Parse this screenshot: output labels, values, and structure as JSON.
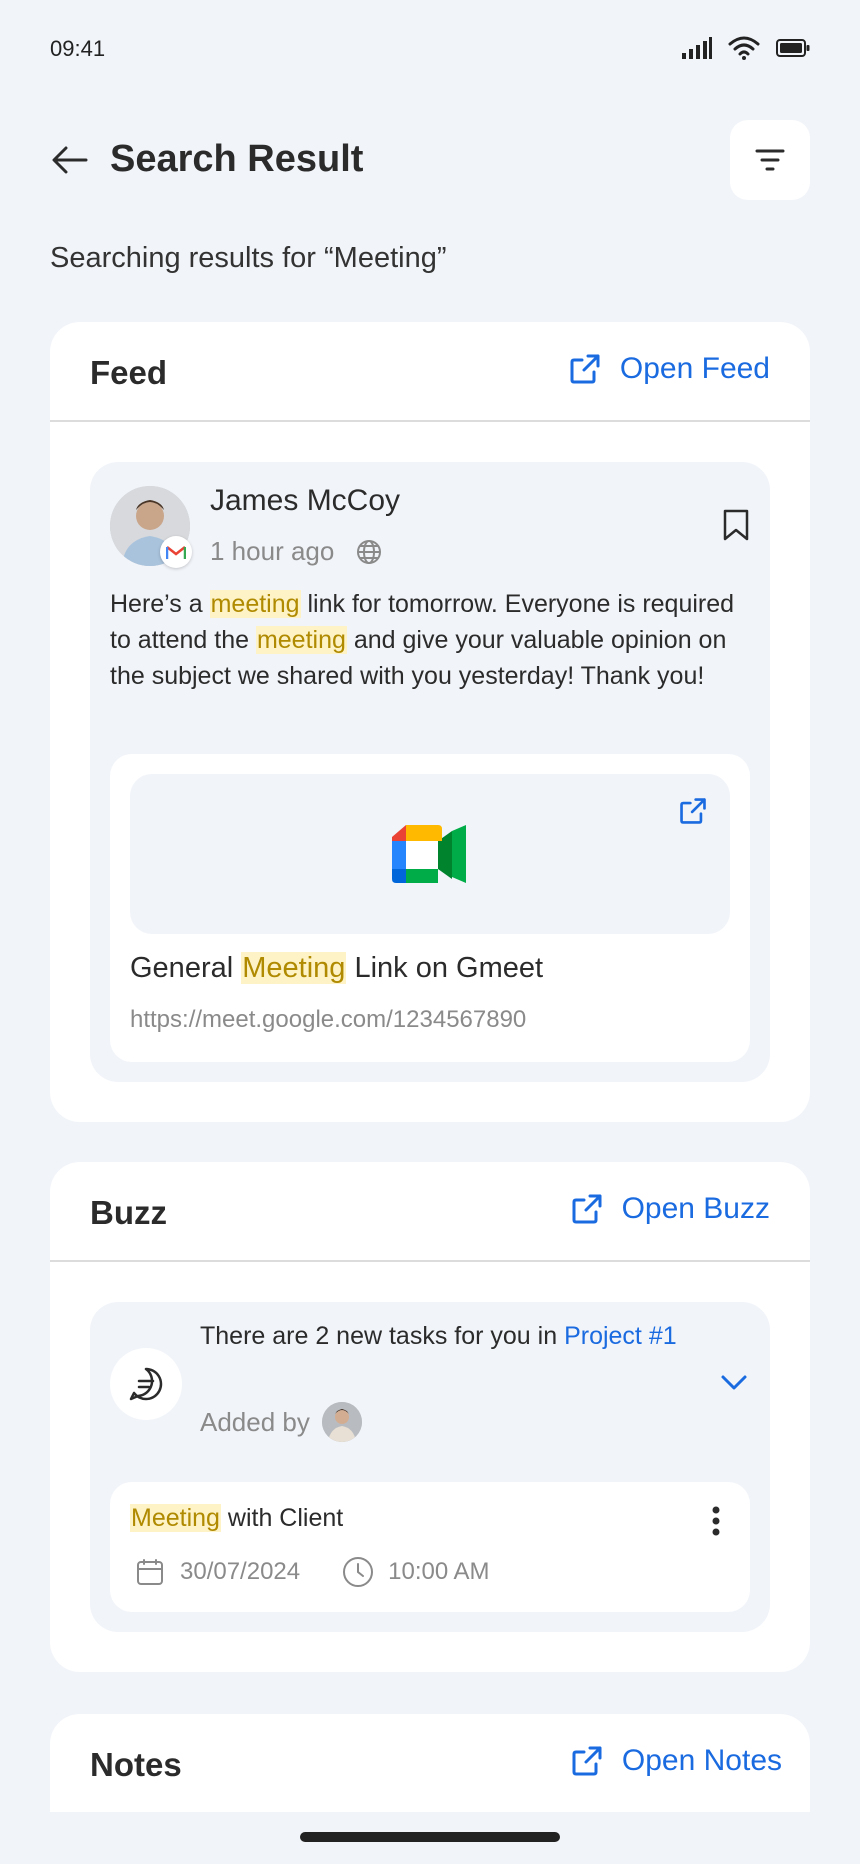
{
  "status": {
    "time": "09:41"
  },
  "header": {
    "title": "Search Result"
  },
  "search": {
    "prefix": "Searching results for “",
    "query": "Meeting",
    "suffix": "”"
  },
  "feed": {
    "title": "Feed",
    "open_label": "Open Feed",
    "post": {
      "author": "James McCoy",
      "time": "1 hour ago",
      "text_parts": [
        "Here’s a ",
        "meeting",
        " link for tomorrow. Everyone is required to attend the ",
        "meeting",
        " and give your valuable opinion on the subject we shared with you yesterday! Thank you!"
      ],
      "link": {
        "title_pre": "General ",
        "title_hl": "Meeting",
        "title_post": " Link on Gmeet",
        "url": "https://meet.google.com/1234567890"
      }
    }
  },
  "buzz": {
    "title": "Buzz",
    "open_label": "Open Buzz",
    "notice": {
      "text": "There are 2 new tasks for you in ",
      "project": "Project #1",
      "added_by": "Added by"
    },
    "task": {
      "title_hl": "Meeting",
      "title_post": " with Client",
      "date": "30/07/2024",
      "time": "10:00 AM"
    }
  },
  "notes": {
    "title": "Notes",
    "open_label": "Open Notes"
  },
  "colors": {
    "accent": "#1a6ae0",
    "highlight_bg": "#fdf3c7",
    "highlight_text": "#b08a00",
    "background": "#f1f4f9"
  }
}
